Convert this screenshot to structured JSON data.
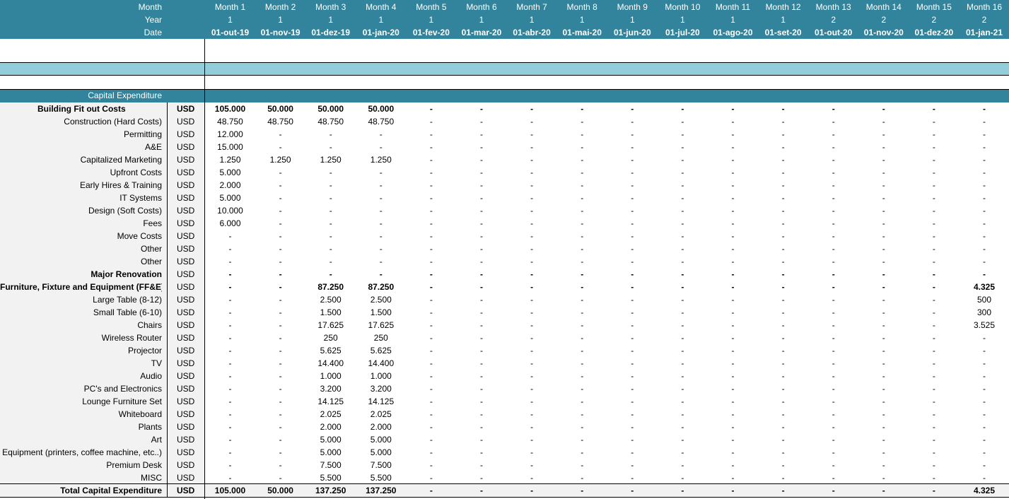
{
  "header": {
    "labels": [
      "Month",
      "Year",
      "Date"
    ],
    "months": [
      "Month 1",
      "Month 2",
      "Month 3",
      "Month 4",
      "Month 5",
      "Month 6",
      "Month 7",
      "Month 8",
      "Month 9",
      "Month 10",
      "Month 11",
      "Month 12",
      "Month 13",
      "Month 14",
      "Month 15",
      "Month 16"
    ],
    "years": [
      "1",
      "1",
      "1",
      "1",
      "1",
      "1",
      "1",
      "1",
      "1",
      "1",
      "1",
      "1",
      "2",
      "2",
      "2",
      "2"
    ],
    "dates": [
      "01-out-19",
      "01-nov-19",
      "01-dez-19",
      "01-jan-20",
      "01-fev-20",
      "01-mar-20",
      "01-abr-20",
      "01-mai-20",
      "01-jun-20",
      "01-jul-20",
      "01-ago-20",
      "01-set-20",
      "01-out-20",
      "01-nov-20",
      "01-dez-20",
      "01-jan-21"
    ]
  },
  "section_title": "Capital Expenditure",
  "colors": {
    "header_teal": "#31849b",
    "band_light": "#92cddc",
    "label_bg": "#f2f2f2"
  },
  "rows": [
    {
      "label": "Building Fit out Costs",
      "unit": "USD",
      "bold": true,
      "values": [
        "105.000",
        "50.000",
        "50.000",
        "50.000",
        "-",
        "-",
        "-",
        "-",
        "-",
        "-",
        "-",
        "-",
        "-",
        "-",
        "-",
        "-"
      ]
    },
    {
      "label": "Construction (Hard Costs)",
      "unit": "USD",
      "bold": false,
      "values": [
        "48.750",
        "48.750",
        "48.750",
        "48.750",
        "-",
        "-",
        "-",
        "-",
        "-",
        "-",
        "-",
        "-",
        "-",
        "-",
        "-",
        "-"
      ]
    },
    {
      "label": "Permitting",
      "unit": "USD",
      "bold": false,
      "values": [
        "12.000",
        "-",
        "-",
        "-",
        "-",
        "-",
        "-",
        "-",
        "-",
        "-",
        "-",
        "-",
        "-",
        "-",
        "-",
        "-"
      ]
    },
    {
      "label": "A&E",
      "unit": "USD",
      "bold": false,
      "values": [
        "15.000",
        "-",
        "-",
        "-",
        "-",
        "-",
        "-",
        "-",
        "-",
        "-",
        "-",
        "-",
        "-",
        "-",
        "-",
        "-"
      ]
    },
    {
      "label": "Capitalized Marketing",
      "unit": "USD",
      "bold": false,
      "values": [
        "1.250",
        "1.250",
        "1.250",
        "1.250",
        "-",
        "-",
        "-",
        "-",
        "-",
        "-",
        "-",
        "-",
        "-",
        "-",
        "-",
        "-"
      ]
    },
    {
      "label": "Upfront Costs",
      "unit": "USD",
      "bold": false,
      "values": [
        "5.000",
        "-",
        "-",
        "-",
        "-",
        "-",
        "-",
        "-",
        "-",
        "-",
        "-",
        "-",
        "-",
        "-",
        "-",
        "-"
      ]
    },
    {
      "label": "Early Hires & Training",
      "unit": "USD",
      "bold": false,
      "values": [
        "2.000",
        "-",
        "-",
        "-",
        "-",
        "-",
        "-",
        "-",
        "-",
        "-",
        "-",
        "-",
        "-",
        "-",
        "-",
        "-"
      ]
    },
    {
      "label": "IT Systems",
      "unit": "USD",
      "bold": false,
      "values": [
        "5.000",
        "-",
        "-",
        "-",
        "-",
        "-",
        "-",
        "-",
        "-",
        "-",
        "-",
        "-",
        "-",
        "-",
        "-",
        "-"
      ]
    },
    {
      "label": "Design (Soft Costs)",
      "unit": "USD",
      "bold": false,
      "values": [
        "10.000",
        "-",
        "-",
        "-",
        "-",
        "-",
        "-",
        "-",
        "-",
        "-",
        "-",
        "-",
        "-",
        "-",
        "-",
        "-"
      ]
    },
    {
      "label": "Fees",
      "unit": "USD",
      "bold": false,
      "values": [
        "6.000",
        "-",
        "-",
        "-",
        "-",
        "-",
        "-",
        "-",
        "-",
        "-",
        "-",
        "-",
        "-",
        "-",
        "-",
        "-"
      ]
    },
    {
      "label": "Move Costs",
      "unit": "USD",
      "bold": false,
      "values": [
        "-",
        "-",
        "-",
        "-",
        "-",
        "-",
        "-",
        "-",
        "-",
        "-",
        "-",
        "-",
        "-",
        "-",
        "-",
        "-"
      ]
    },
    {
      "label": "Other",
      "unit": "USD",
      "bold": false,
      "values": [
        "-",
        "-",
        "-",
        "-",
        "-",
        "-",
        "-",
        "-",
        "-",
        "-",
        "-",
        "-",
        "-",
        "-",
        "-",
        "-"
      ]
    },
    {
      "label": "Other",
      "unit": "USD",
      "bold": false,
      "values": [
        "-",
        "-",
        "-",
        "-",
        "-",
        "-",
        "-",
        "-",
        "-",
        "-",
        "-",
        "-",
        "-",
        "-",
        "-",
        "-"
      ]
    },
    {
      "label": "Major Renovation",
      "unit": "USD",
      "bold": true,
      "values": [
        "-",
        "-",
        "-",
        "-",
        "-",
        "-",
        "-",
        "-",
        "-",
        "-",
        "-",
        "-",
        "-",
        "-",
        "-",
        "-"
      ]
    },
    {
      "label": "Furniture, Fixture and Equipment (FF&E)",
      "unit": "USD",
      "bold": true,
      "values": [
        "-",
        "-",
        "87.250",
        "87.250",
        "-",
        "-",
        "-",
        "-",
        "-",
        "-",
        "-",
        "-",
        "-",
        "-",
        "-",
        "4.325"
      ]
    },
    {
      "label": "Large Table (8-12)",
      "unit": "USD",
      "bold": false,
      "values": [
        "-",
        "-",
        "2.500",
        "2.500",
        "-",
        "-",
        "-",
        "-",
        "-",
        "-",
        "-",
        "-",
        "-",
        "-",
        "-",
        "500"
      ]
    },
    {
      "label": "Small Table (6-10)",
      "unit": "USD",
      "bold": false,
      "values": [
        "-",
        "-",
        "1.500",
        "1.500",
        "-",
        "-",
        "-",
        "-",
        "-",
        "-",
        "-",
        "-",
        "-",
        "-",
        "-",
        "300"
      ]
    },
    {
      "label": "Chairs",
      "unit": "USD",
      "bold": false,
      "values": [
        "-",
        "-",
        "17.625",
        "17.625",
        "-",
        "-",
        "-",
        "-",
        "-",
        "-",
        "-",
        "-",
        "-",
        "-",
        "-",
        "3.525"
      ]
    },
    {
      "label": "Wireless Router",
      "unit": "USD",
      "bold": false,
      "values": [
        "-",
        "-",
        "250",
        "250",
        "-",
        "-",
        "-",
        "-",
        "-",
        "-",
        "-",
        "-",
        "-",
        "-",
        "-",
        "-"
      ]
    },
    {
      "label": "Projector",
      "unit": "USD",
      "bold": false,
      "values": [
        "-",
        "-",
        "5.625",
        "5.625",
        "-",
        "-",
        "-",
        "-",
        "-",
        "-",
        "-",
        "-",
        "-",
        "-",
        "-",
        "-"
      ]
    },
    {
      "label": "TV",
      "unit": "USD",
      "bold": false,
      "values": [
        "-",
        "-",
        "14.400",
        "14.400",
        "-",
        "-",
        "-",
        "-",
        "-",
        "-",
        "-",
        "-",
        "-",
        "-",
        "-",
        "-"
      ]
    },
    {
      "label": "Audio",
      "unit": "USD",
      "bold": false,
      "values": [
        "-",
        "-",
        "1.000",
        "1.000",
        "-",
        "-",
        "-",
        "-",
        "-",
        "-",
        "-",
        "-",
        "-",
        "-",
        "-",
        "-"
      ]
    },
    {
      "label": "PC's and Electronics",
      "unit": "USD",
      "bold": false,
      "values": [
        "-",
        "-",
        "3.200",
        "3.200",
        "-",
        "-",
        "-",
        "-",
        "-",
        "-",
        "-",
        "-",
        "-",
        "-",
        "-",
        "-"
      ]
    },
    {
      "label": "Lounge Furniture Set",
      "unit": "USD",
      "bold": false,
      "values": [
        "-",
        "-",
        "14.125",
        "14.125",
        "-",
        "-",
        "-",
        "-",
        "-",
        "-",
        "-",
        "-",
        "-",
        "-",
        "-",
        "-"
      ]
    },
    {
      "label": "Whiteboard",
      "unit": "USD",
      "bold": false,
      "values": [
        "-",
        "-",
        "2.025",
        "2.025",
        "-",
        "-",
        "-",
        "-",
        "-",
        "-",
        "-",
        "-",
        "-",
        "-",
        "-",
        "-"
      ]
    },
    {
      "label": "Plants",
      "unit": "USD",
      "bold": false,
      "values": [
        "-",
        "-",
        "2.000",
        "2.000",
        "-",
        "-",
        "-",
        "-",
        "-",
        "-",
        "-",
        "-",
        "-",
        "-",
        "-",
        "-"
      ]
    },
    {
      "label": "Art",
      "unit": "USD",
      "bold": false,
      "values": [
        "-",
        "-",
        "5.000",
        "5.000",
        "-",
        "-",
        "-",
        "-",
        "-",
        "-",
        "-",
        "-",
        "-",
        "-",
        "-",
        "-"
      ]
    },
    {
      "label": "Equipment (printers, coffee machine, etc..)",
      "unit": "USD",
      "bold": false,
      "values": [
        "-",
        "-",
        "5.000",
        "5.000",
        "-",
        "-",
        "-",
        "-",
        "-",
        "-",
        "-",
        "-",
        "-",
        "-",
        "-",
        "-"
      ]
    },
    {
      "label": "Premium Desk",
      "unit": "USD",
      "bold": false,
      "values": [
        "-",
        "-",
        "7.500",
        "7.500",
        "-",
        "-",
        "-",
        "-",
        "-",
        "-",
        "-",
        "-",
        "-",
        "-",
        "-",
        "-"
      ]
    },
    {
      "label": "MISC",
      "unit": "USD",
      "bold": false,
      "values": [
        "-",
        "-",
        "5.500",
        "5.500",
        "-",
        "-",
        "-",
        "-",
        "-",
        "-",
        "-",
        "-",
        "-",
        "-",
        "-",
        "-"
      ]
    }
  ],
  "total": {
    "label": "Total Capital Expenditure",
    "unit": "USD",
    "values": [
      "105.000",
      "50.000",
      "137.250",
      "137.250",
      "-",
      "-",
      "-",
      "-",
      "-",
      "-",
      "-",
      "-",
      "-",
      "-",
      "-",
      "4.325"
    ]
  }
}
